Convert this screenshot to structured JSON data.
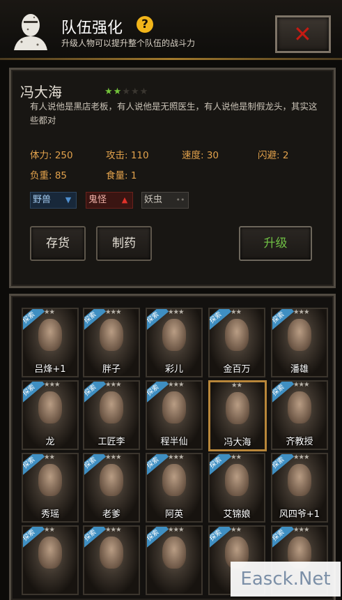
{
  "header": {
    "title": "队伍强化",
    "help": "?",
    "subtitle": "升级人物可以提升整个队伍的战斗力",
    "close": "✕"
  },
  "character": {
    "name": "冯大海",
    "stars_filled": 2,
    "stars_total": 5,
    "description": "有人说他是黑店老板，有人说他是无照医生，有人说他是制假龙头，其实这些都对",
    "stats": {
      "hp": "体力: 250",
      "attack": "攻击: 110",
      "speed": "速度: 30",
      "dodge": "闪避: 2",
      "load": "负重: 85",
      "food": "食量: 1"
    },
    "tags": [
      {
        "label": "野兽",
        "arrow": "down",
        "color": "#3d6fa3"
      },
      {
        "label": "鬼怪",
        "arrow": "up",
        "color": "#b3241f"
      },
      {
        "label": "妖虫",
        "arrow": "none",
        "color": "#7d7a74"
      }
    ]
  },
  "buttons": {
    "inventory": "存货",
    "medicine": "制药",
    "upgrade": "升级"
  },
  "badge_text": "探索",
  "roster": [
    {
      "name": "吕烽+1",
      "stars": "★★",
      "badge": true
    },
    {
      "name": "胖子",
      "stars": "★★★",
      "badge": true
    },
    {
      "name": "彩儿",
      "stars": "★★★",
      "badge": true
    },
    {
      "name": "金百万",
      "stars": "★★",
      "badge": true
    },
    {
      "name": "潘雄",
      "stars": "★★★",
      "badge": true
    },
    {
      "name": "龙",
      "stars": "★★★",
      "badge": true
    },
    {
      "name": "工匠李",
      "stars": "★★★",
      "badge": true
    },
    {
      "name": "程半仙",
      "stars": "★★★",
      "badge": true
    },
    {
      "name": "冯大海",
      "stars": "★★",
      "badge": false
    },
    {
      "name": "齐教授",
      "stars": "★★★",
      "badge": true
    },
    {
      "name": "秀瑶",
      "stars": "★★",
      "badge": true
    },
    {
      "name": "老爹",
      "stars": "★★★",
      "badge": true
    },
    {
      "name": "阿英",
      "stars": "★★★",
      "badge": true
    },
    {
      "name": "艾锦娘",
      "stars": "★★",
      "badge": true
    },
    {
      "name": "风四爷+1",
      "stars": "★★★",
      "badge": true
    },
    {
      "name": "",
      "stars": "★★",
      "badge": true
    },
    {
      "name": "",
      "stars": "★★★",
      "badge": true
    },
    {
      "name": "",
      "stars": "★★★",
      "badge": true
    },
    {
      "name": "",
      "stars": "★★",
      "badge": true
    },
    {
      "name": "",
      "stars": "★★★",
      "badge": true
    }
  ],
  "selected_index": 8,
  "watermark": "Easck.Net"
}
